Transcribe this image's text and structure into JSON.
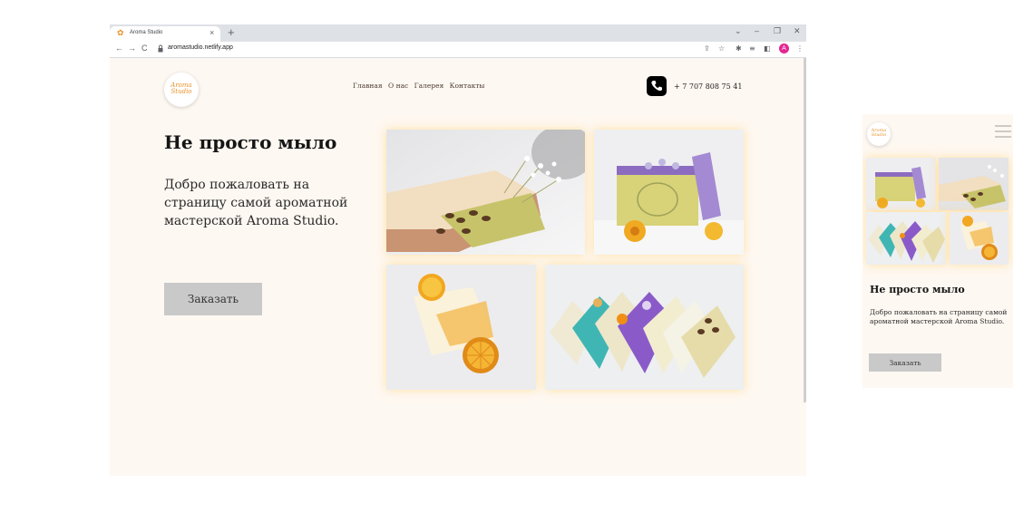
{
  "browser": {
    "tab_title": "Aroma Studio",
    "tab_close": "×",
    "new_tab": "+",
    "url": "aromastudio.netlify.app",
    "profile_initial": "A"
  },
  "brand": {
    "logo_line1": "Aroma",
    "logo_line2": "Studio",
    "accent_color": "#e8912d"
  },
  "nav": {
    "items": [
      "Главная",
      "О нас",
      "Галерея",
      "Контакты"
    ]
  },
  "contact": {
    "phone": "+ 7 707 808 75 41"
  },
  "hero": {
    "title": "Не просто мыло",
    "lead": "Добро пожаловать на страницу самой ароматной мастерской Aroma Studio.",
    "order_button": "Заказать"
  },
  "colors": {
    "page_bg": "#fef8f2",
    "button_bg": "#c9c9c9"
  }
}
